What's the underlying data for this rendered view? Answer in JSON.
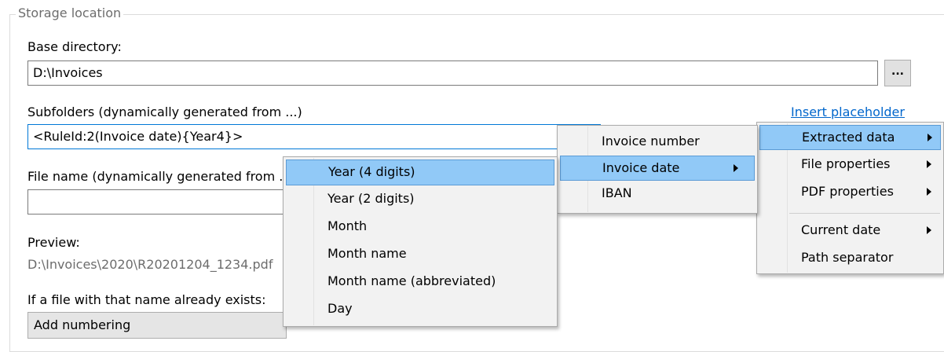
{
  "groupbox": {
    "legend": "Storage location"
  },
  "base_directory": {
    "label": "Base directory:",
    "value": "D:\\Invoices",
    "browse_label": "..."
  },
  "subfolders": {
    "label": "Subfolders (dynamically generated from ...)",
    "value": "<RuleId:2(Invoice date){Year4}>",
    "insert_link": "Insert placeholder"
  },
  "file_name": {
    "label": "File name (dynamically generated from ...)",
    "value": ""
  },
  "preview": {
    "label": "Preview:",
    "value": "D:\\Invoices\\2020\\R20201204_1234.pdf"
  },
  "exists": {
    "label": "If a file with that name already exists:",
    "selected": "Add numbering"
  },
  "menu_placeholder": {
    "items": [
      "Extracted data",
      "File properties",
      "PDF properties",
      "Current date",
      "Path separator"
    ]
  },
  "menu_extracted": {
    "items": [
      "Invoice number",
      "Invoice date",
      "IBAN"
    ]
  },
  "menu_date": {
    "items": [
      "Year (4 digits)",
      "Year (2 digits)",
      "Month",
      "Month name",
      "Month name (abbreviated)",
      "Day"
    ]
  },
  "colors": {
    "highlight": "#91c9f7",
    "link": "#0066cc",
    "focus_border": "#0078d7"
  }
}
